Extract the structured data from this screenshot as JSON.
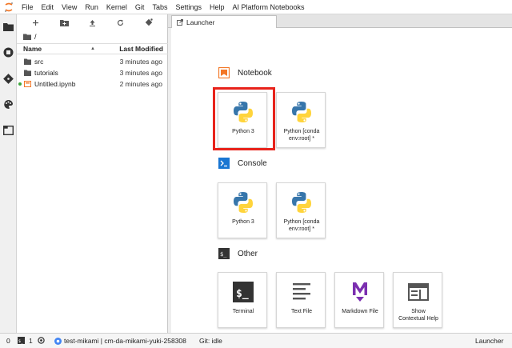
{
  "menubar": {
    "logo_icon": "jupyter-logo-icon",
    "items": [
      "File",
      "Edit",
      "View",
      "Run",
      "Kernel",
      "Git",
      "Tabs",
      "Settings",
      "Help",
      "AI Platform Notebooks"
    ]
  },
  "activity_bar": {
    "icons": [
      "folder-icon",
      "running-kernels-icon",
      "git-icon",
      "palette-icon",
      "tabs-icon"
    ]
  },
  "file_browser": {
    "toolbar_icons": [
      "new-launcher-icon",
      "new-folder-icon",
      "upload-icon",
      "refresh-icon",
      "git-clone-icon"
    ],
    "path": "/",
    "columns": {
      "name": "Name",
      "modified": "Last Modified"
    },
    "files": [
      {
        "name": "src",
        "modified": "3 minutes ago",
        "type": "folder"
      },
      {
        "name": "tutorials",
        "modified": "3 minutes ago",
        "type": "folder"
      },
      {
        "name": "Untitled.ipynb",
        "modified": "2 minutes ago",
        "type": "notebook"
      }
    ]
  },
  "tabs": [
    {
      "label": "Launcher"
    }
  ],
  "launcher": {
    "sections": [
      {
        "title": "Notebook",
        "cards": [
          {
            "label": "Python 3"
          },
          {
            "label": "Python [conda\nenv:root] *"
          }
        ]
      },
      {
        "title": "Console",
        "cards": [
          {
            "label": "Python 3"
          },
          {
            "label": "Python [conda\nenv:root] *"
          }
        ]
      },
      {
        "title": "Other",
        "cards": [
          {
            "label": "Terminal"
          },
          {
            "label": "Text File"
          },
          {
            "label": "Markdown File"
          },
          {
            "label": "Show\nContextual Help"
          }
        ]
      }
    ]
  },
  "statusbar": {
    "kernel_count": "0",
    "terminal_count": "1",
    "project_name": "test-mikami | cm-da-mikami-yuki-258308",
    "git_status": "Git: idle",
    "mode": "Launcher"
  },
  "colors": {
    "highlight": "#e8231b",
    "notebook_orange": "#f37726",
    "markdown_purple": "#7b2fb0"
  }
}
